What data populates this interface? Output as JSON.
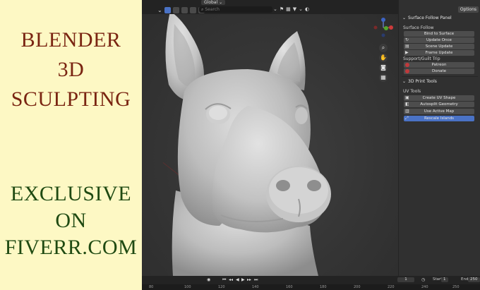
{
  "promo": {
    "line1": "BLENDER",
    "line2": "3D",
    "line3": "SCULPTING",
    "line4": "EXCLUSIVE",
    "line5": "ON",
    "line6": "FIVERR.COM",
    "colors": {
      "top": "#7a2512",
      "bottom": "#1f4a12",
      "background": "#fdf8c4"
    }
  },
  "header": {
    "orientation": "Global",
    "search_placeholder": "Search"
  },
  "sidebar": {
    "options_label": "Options",
    "surface_follow": {
      "panel_title": "Surface Follow Panel",
      "section_label": "Surface Follow",
      "bind_label": "Bind to Surface",
      "update_once_label": "Update Once",
      "scene_update_label": "Scene Update",
      "frame_update_label": "Frame Update",
      "support_label": "Support/Guilt Trip",
      "patreon_label": "Patreon",
      "donate_label": "Donate"
    },
    "print_tools": {
      "panel_title": "3D Print Tools",
      "section_label": "UV Tools",
      "create_uv_label": "Create UV Shape",
      "autosplit_label": "Autosplit Geometry",
      "use_active_label": "Use Active Map",
      "rescale_label": "Rescale Islands"
    }
  },
  "timeline": {
    "current_frame": "1",
    "start_label": "Start",
    "start_value": "1",
    "end_label": "End",
    "end_value": "250",
    "ruler_ticks": [
      "80",
      "100",
      "120",
      "140",
      "160",
      "180",
      "200",
      "220",
      "240",
      "250"
    ]
  },
  "colors": {
    "accent": "#4a72c5",
    "viewport_bg": "#353535",
    "sculpt": "#c9c9c9"
  }
}
